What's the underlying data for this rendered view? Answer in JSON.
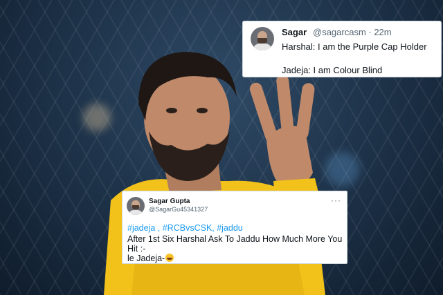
{
  "tweet_top": {
    "name": "Sagar",
    "handle": "@sagarcasm · 22m",
    "line1": "Harshal: I am the Purple Cap Holder",
    "line2": "Jadeja: I am Colour Blind"
  },
  "tweet_bottom": {
    "name": "Sagar Gupta",
    "handle": "@SagarGu45341327",
    "more": "···",
    "hashtags": "#jadeja , #RCBvsCSK, #jaddu",
    "line1": "After 1st Six Harshal Ask To Jaddu How Much More You",
    "line2": "Hit :-",
    "line3": "le Jadeja-"
  },
  "icons": {
    "avatar": "avatar-photo",
    "more": "more-icon",
    "emoji": "rofl-emoji"
  },
  "colors": {
    "link": "#1d9bf0",
    "jersey": "#f2c21a",
    "handle": "#536471"
  }
}
